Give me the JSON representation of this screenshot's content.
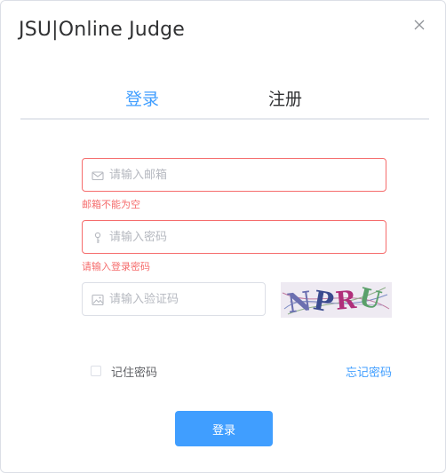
{
  "dialog": {
    "title": "JSU|Online Judge"
  },
  "tabs": {
    "login": "登录",
    "register": "注册"
  },
  "form": {
    "email": {
      "placeholder": "请输入邮箱",
      "value": "",
      "error": "邮箱不能为空"
    },
    "password": {
      "placeholder": "请输入密码",
      "value": "",
      "error": "请输入登录密码"
    },
    "captcha": {
      "placeholder": "请输入验证码",
      "value": "",
      "image_text": "NPRU"
    },
    "remember_label": "记住密码",
    "forgot_label": "忘记密码",
    "submit_label": "登录"
  },
  "colors": {
    "accent": "#409eff",
    "error": "#f56c6c",
    "border": "#dcdfe6"
  },
  "icons": {
    "close": "close-icon",
    "email": "mail-icon",
    "password": "key-icon",
    "captcha": "image-icon"
  }
}
